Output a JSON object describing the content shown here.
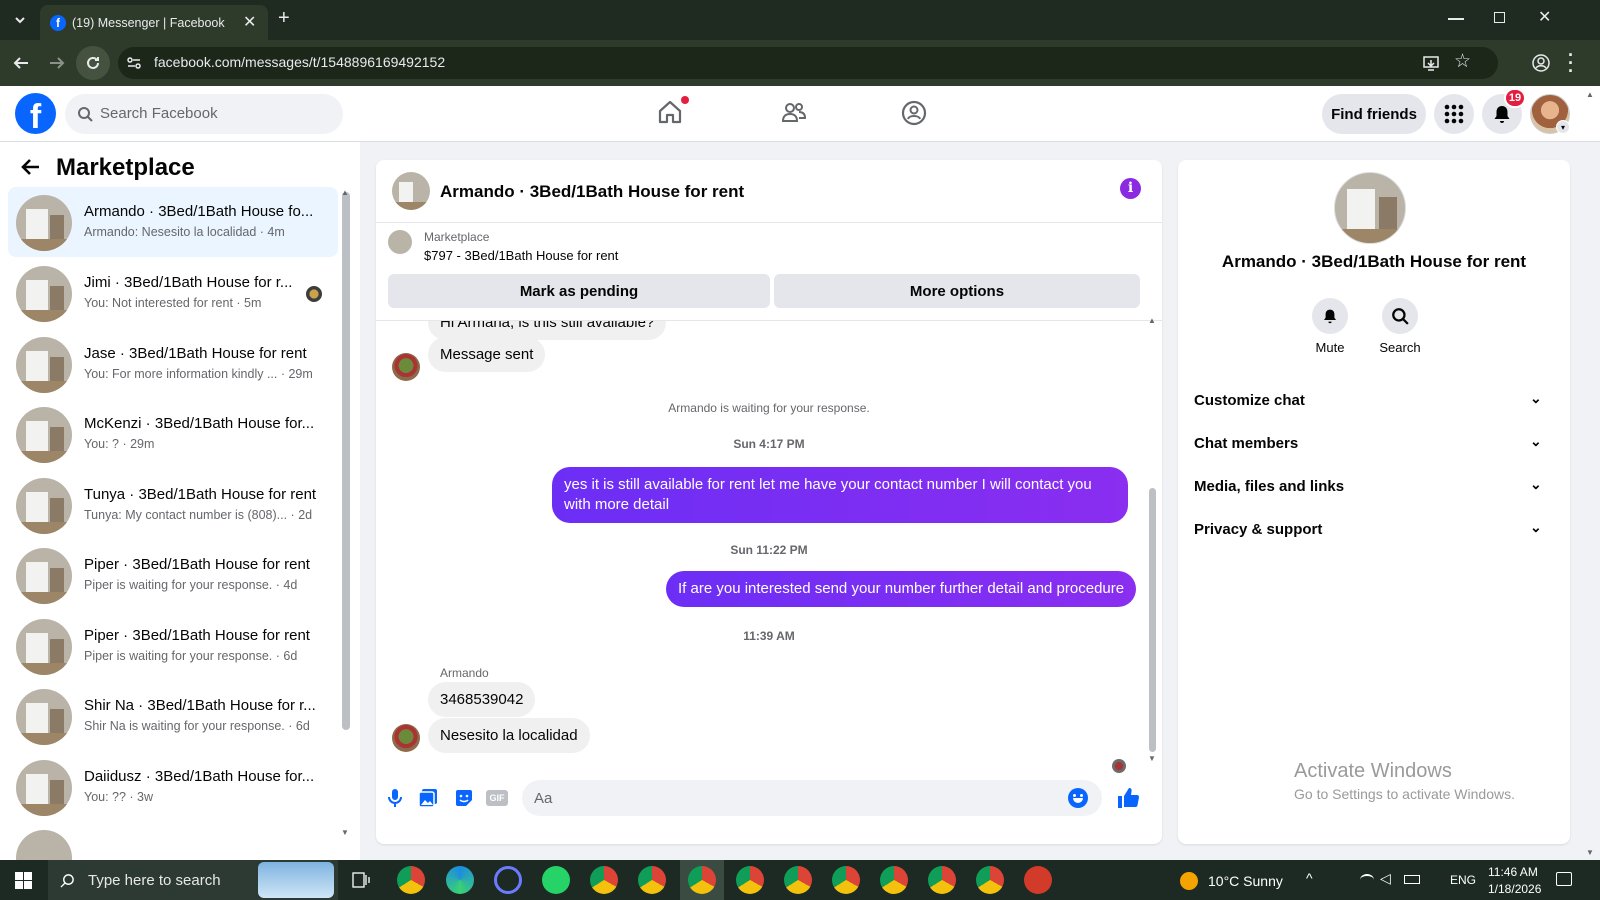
{
  "browser": {
    "tab_title": "(19) Messenger | Facebook",
    "url": "facebook.com/messages/t/1548896169492152"
  },
  "header": {
    "search_placeholder": "Search Facebook",
    "find_friends": "Find friends",
    "notification_count": "19",
    "brand_color": "#0866ff"
  },
  "sidebar": {
    "title": "Marketplace",
    "conversations": [
      {
        "name": "Armando · 3Bed/1Bath House fo...",
        "snippet": "Armando: Nesesito la localidad · 4m"
      },
      {
        "name": "Jimi · 3Bed/1Bath House for r...",
        "snippet": "You: Not interested for rent · 5m"
      },
      {
        "name": "Jase · 3Bed/1Bath House for rent",
        "snippet": "You: For more information kindly ... · 29m"
      },
      {
        "name": "McKenzi · 3Bed/1Bath House for...",
        "snippet": "You: ? · 29m"
      },
      {
        "name": "Tunya · 3Bed/1Bath House for rent",
        "snippet": "Tunya: My contact number is (808)... · 2d"
      },
      {
        "name": "Piper · 3Bed/1Bath House for rent",
        "snippet": "Piper is waiting for your response. · 4d"
      },
      {
        "name": "Piper · 3Bed/1Bath House for rent",
        "snippet": "Piper is waiting for your response. · 6d"
      },
      {
        "name": "Shir Na · 3Bed/1Bath House for r...",
        "snippet": "Shir Na is waiting for your response. · 6d"
      },
      {
        "name": "Daiidusz · 3Bed/1Bath House for...",
        "snippet": "You: ?? · 3w"
      }
    ]
  },
  "chat": {
    "title": "Armando · 3Bed/1Bath House for rent",
    "listing_label": "Marketplace",
    "listing_desc": "$797 - 3Bed/1Bath House for rent",
    "mark_pending": "Mark as pending",
    "more_options": "More options",
    "cut_message": "Hi Armana, is this still available?",
    "message_sent": "Message sent",
    "waiting_notice": "Armando is waiting for your response.",
    "ts1": "Sun 4:17 PM",
    "out1": "yes it is still available for rent let me have your contact number I will contact you with more detail",
    "ts2": "Sun 11:22 PM",
    "out2": "If are you interested send your number further detail and procedure",
    "ts3": "11:39 AM",
    "sender": "Armando",
    "in1": "3468539042",
    "in2": "Nesesito la localidad",
    "composer_placeholder": "Aa",
    "accent": "#7b2ff7"
  },
  "details": {
    "name": "Armando · 3Bed/1Bath House for rent",
    "mute": "Mute",
    "search": "Search",
    "sections": [
      "Customize chat",
      "Chat members",
      "Media, files and links",
      "Privacy & support"
    ]
  },
  "watermark": {
    "line1": "Activate Windows",
    "line2": "Go to Settings to activate Windows."
  },
  "taskbar": {
    "search_placeholder": "Type here to search",
    "weather": "10°C  Sunny",
    "lang": "ENG",
    "time": "11:46 AM",
    "date": "1/18/2026"
  }
}
